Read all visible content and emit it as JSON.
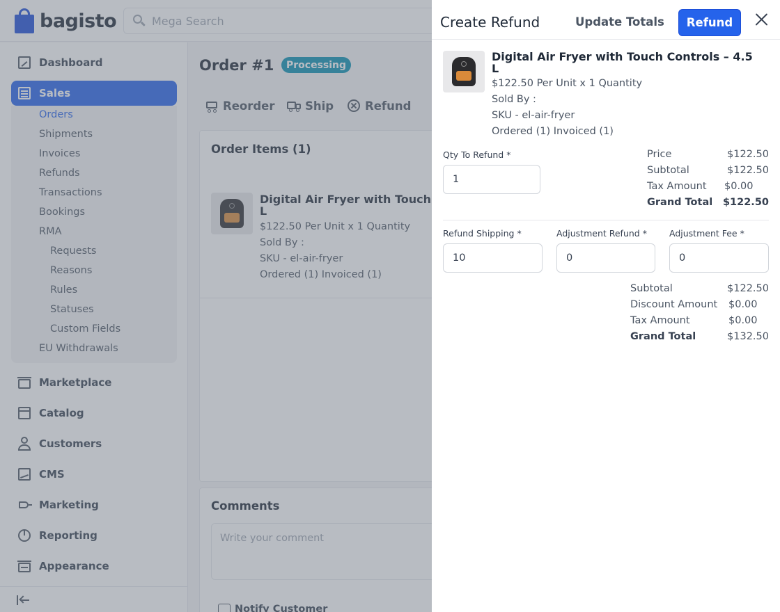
{
  "brand": {
    "name": "bagisto"
  },
  "search": {
    "placeholder": "Mega Search"
  },
  "sidebar": {
    "dashboard": "Dashboard",
    "sales": "Sales",
    "sales_items": [
      "Orders",
      "Shipments",
      "Invoices",
      "Refunds",
      "Transactions",
      "Bookings",
      "RMA"
    ],
    "rma_items": [
      "Requests",
      "Reasons",
      "Rules",
      "Statuses",
      "Custom Fields"
    ],
    "eu_withdrawals": "EU Withdrawals",
    "marketplace": "Marketplace",
    "catalog": "Catalog",
    "customers": "Customers",
    "cms": "CMS",
    "marketing": "Marketing",
    "reporting": "Reporting",
    "appearance": "Appearance"
  },
  "order": {
    "title": "Order #1",
    "status": "Processing",
    "actions": {
      "reorder": "Reorder",
      "ship": "Ship",
      "refund": "Refund"
    },
    "items_title": "Order Items (1)",
    "item": {
      "name_line1": "Digital Air Fryer with Touch",
      "name_line2": "L",
      "price_line": "$122.50 Per Unit x 1 Quantity",
      "sold_by": "Sold By :",
      "sku": "SKU - el-air-fryer",
      "ordered": "Ordered (1) Invoiced (1)"
    },
    "comments_title": "Comments",
    "comment_placeholder": "Write your comment",
    "notify_label": "Notify Customer"
  },
  "drawer": {
    "title": "Create Refund",
    "update_totals": "Update Totals",
    "refund_button": "Refund",
    "product": {
      "name_line1": "Digital Air Fryer with Touch Controls – 4.5",
      "name_line2": "L",
      "price_line": "$122.50 Per Unit x 1 Quantity",
      "sold_by": "Sold By :",
      "sku": "SKU - el-air-fryer",
      "ordered": "Ordered (1) Invoiced (1)"
    },
    "qty_label": "Qty To Refund *",
    "qty_value": "1",
    "item_summary": [
      {
        "label": "Price",
        "value": "$122.50"
      },
      {
        "label": "Subtotal",
        "value": "$122.50"
      },
      {
        "label": "Tax Amount",
        "value": "$0.00"
      },
      {
        "label": "Grand Total",
        "value": "$122.50"
      }
    ],
    "refund_shipping_label": "Refund Shipping *",
    "refund_shipping_value": "10",
    "adjustment_refund_label": "Adjustment Refund *",
    "adjustment_refund_value": "0",
    "adjustment_fee_label": "Adjustment Fee *",
    "adjustment_fee_value": "0",
    "totals": [
      {
        "label": "Subtotal",
        "value": "$122.50"
      },
      {
        "label": "Discount Amount",
        "value": "$0.00"
      },
      {
        "label": "Tax Amount",
        "value": "$0.00"
      },
      {
        "label": "Grand Total",
        "value": "$132.50"
      }
    ]
  }
}
